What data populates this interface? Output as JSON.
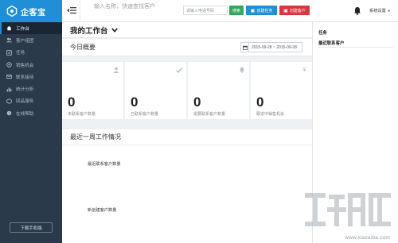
{
  "app": {
    "brand": "企客宝"
  },
  "sidebar": {
    "items": [
      {
        "label": "工作台",
        "icon": "home-icon",
        "active": true
      },
      {
        "label": "客户组团",
        "icon": "people-icon",
        "active": false
      },
      {
        "label": "任务",
        "icon": "task-icon",
        "active": false
      },
      {
        "label": "销售机会",
        "icon": "opportunity-icon",
        "active": false
      },
      {
        "label": "联系接待",
        "icon": "contact-icon",
        "active": false
      },
      {
        "label": "统计分析",
        "icon": "chart-icon",
        "active": false
      },
      {
        "label": "回品服务",
        "icon": "service-icon",
        "active": false
      },
      {
        "label": "在线帮助",
        "icon": "help-icon",
        "active": false
      }
    ],
    "download_label": "下载手机端"
  },
  "topbar": {
    "search_placeholder": "输入名称，快速查找客户",
    "phone_placeholder": "请输入电话号码",
    "search_button": "搜索",
    "create_task_button": "创建任务",
    "create_customer_button": "创建客户",
    "settings_label": "系统设置"
  },
  "main": {
    "page_title": "我的工作台",
    "overview_title": "今日概要",
    "date_range": "2015-09-28 ~ 2015-09-28",
    "stats": [
      {
        "value": "0",
        "label": "未联系客户数量",
        "icon": "person-icon"
      },
      {
        "value": "0",
        "label": "已联系客户数量",
        "icon": "check-icon"
      },
      {
        "value": "0",
        "label": "需要联系客户数量",
        "icon": "bell-icon"
      },
      {
        "value": "0",
        "label": "跟进中销售机会",
        "icon": "yen-icon"
      }
    ],
    "week_title": "最近一周工作情况",
    "chart_labels": [
      "最近联系客户数量",
      "新创建客户数量"
    ]
  },
  "right_panel": {
    "items": [
      "任务",
      "最近联系客户"
    ]
  },
  "watermark": {
    "url": "www.xiazaiba.com"
  },
  "colors": {
    "sidebar_bg": "#2b3a4a",
    "accent_blue": "#1f8fd8",
    "search_green": "#2eaa5e",
    "customer_red": "#d9363e"
  }
}
